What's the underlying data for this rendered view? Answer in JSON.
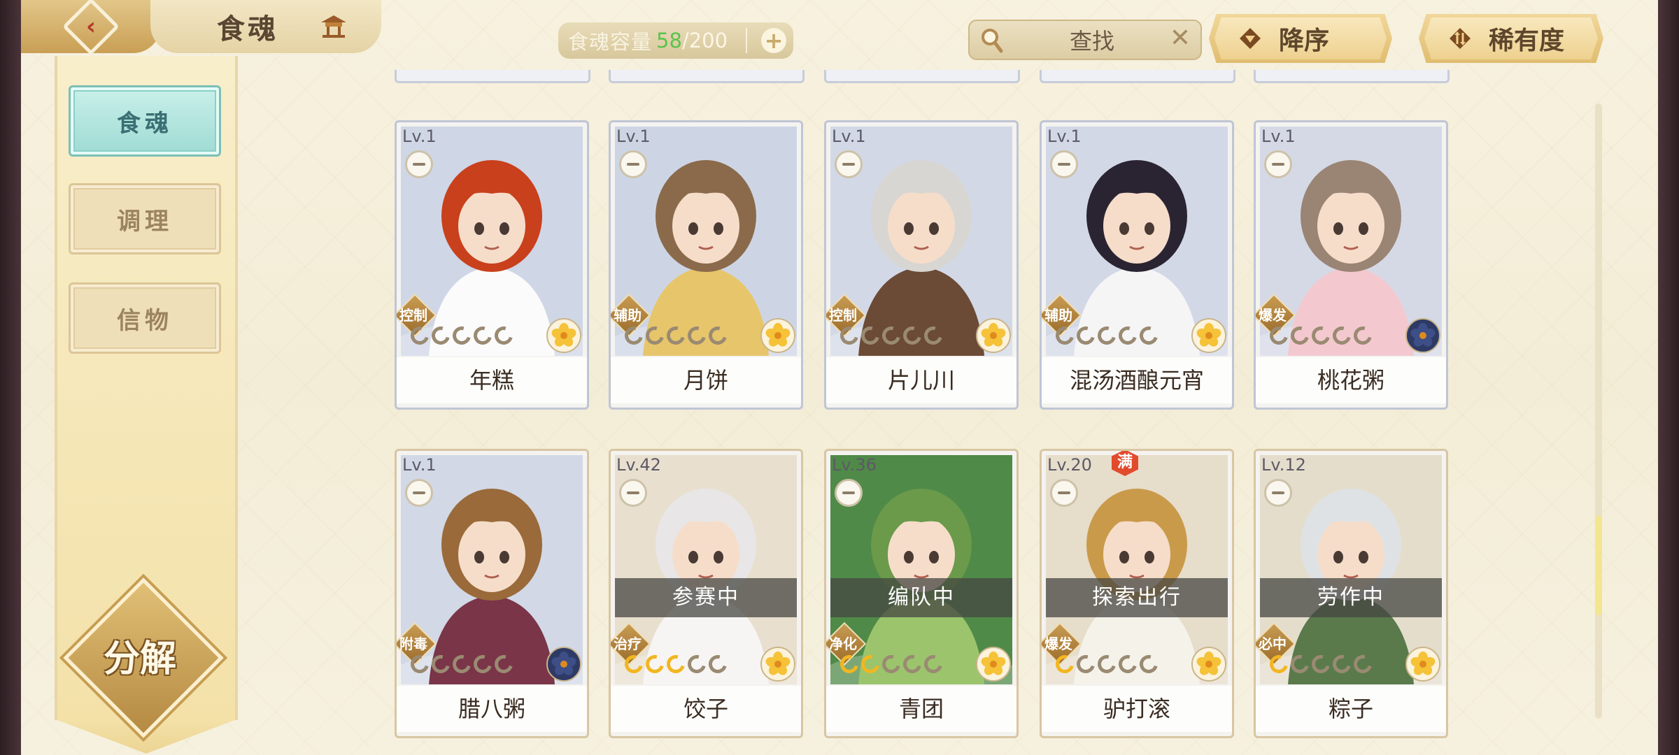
{
  "header": {
    "back_icon": "back-arrow-icon",
    "title": "食魂",
    "capacity_label": "食魂容量",
    "capacity_current": "58",
    "capacity_total": "/200",
    "capacity_add": "+",
    "search_placeholder": "查找",
    "search_clear": "✕",
    "sort_order_label": "降序",
    "sort_field_label": "稀有度"
  },
  "sidebar": {
    "items": [
      {
        "label": "食魂",
        "active": true
      },
      {
        "label": "调理",
        "active": false
      },
      {
        "label": "信物",
        "active": false
      }
    ],
    "decompose_label": "分解"
  },
  "cards": [
    {
      "level": "Lv.1",
      "role": "控制",
      "name": "年糕",
      "stars": 0,
      "status": "",
      "maxed": false,
      "bg": "#cfd6e6",
      "hair": "#c8401c",
      "cloth": "#fbfbfb",
      "flower": "gold"
    },
    {
      "level": "Lv.1",
      "role": "辅助",
      "name": "月饼",
      "stars": 0,
      "status": "",
      "maxed": false,
      "bg": "#cdd5e5",
      "hair": "#8a6a4a",
      "cloth": "#e7c56b",
      "flower": "gold"
    },
    {
      "level": "Lv.1",
      "role": "控制",
      "name": "片儿川",
      "stars": 0,
      "status": "",
      "maxed": false,
      "bg": "#d2d8e6",
      "hair": "#d8d6d2",
      "cloth": "#6b4a36",
      "flower": "gold"
    },
    {
      "level": "Lv.1",
      "role": "辅助",
      "name": "混汤酒酿元宵",
      "stars": 0,
      "status": "",
      "maxed": false,
      "bg": "#d3d8e7",
      "hair": "#2a2432",
      "cloth": "#f5f5f5",
      "flower": "gold"
    },
    {
      "level": "Lv.1",
      "role": "爆发",
      "name": "桃花粥",
      "stars": 0,
      "status": "",
      "maxed": false,
      "bg": "#d5d9e6",
      "hair": "#9a8474",
      "cloth": "#f3c9cf",
      "flower": "blue"
    },
    {
      "level": "Lv.1",
      "role": "附毒",
      "name": "腊八粥",
      "stars": 0,
      "status": "",
      "maxed": false,
      "bg": "#d2d8e6",
      "hair": "#9a6a3a",
      "cloth": "#7a3548",
      "flower": "blue"
    },
    {
      "level": "Lv.42",
      "role": "治疗",
      "name": "饺子",
      "stars": 3,
      "status": "参赛中",
      "maxed": false,
      "bg": "#e8dfcf",
      "hair": "#e8e6e6",
      "cloth": "#f7f5f3",
      "flower": "gold"
    },
    {
      "level": "Lv.36",
      "role": "净化",
      "name": "青团",
      "stars": 2,
      "status": "编队中",
      "maxed": false,
      "bg": "#4f8a48",
      "hair": "#6a9a4a",
      "cloth": "#9bc46c",
      "flower": "gold"
    },
    {
      "level": "Lv.20",
      "role": "爆发",
      "name": "驴打滚",
      "stars": 1,
      "status": "探索出行",
      "maxed": true,
      "max_label": "满",
      "bg": "#e6ddcb",
      "hair": "#c99a4a",
      "cloth": "#f5f2ea",
      "flower": "gold"
    },
    {
      "level": "Lv.12",
      "role": "必中",
      "name": "粽子",
      "stars": 1,
      "status": "劳作中",
      "maxed": false,
      "bg": "#e4ddcc",
      "hair": "#dfe2e4",
      "cloth": "#5a7a4c",
      "flower": "gold"
    }
  ],
  "colors": {
    "accent_gold": "#f2b620",
    "active_tab": "#9edbd3",
    "capacity_current": "#5cc24c"
  }
}
